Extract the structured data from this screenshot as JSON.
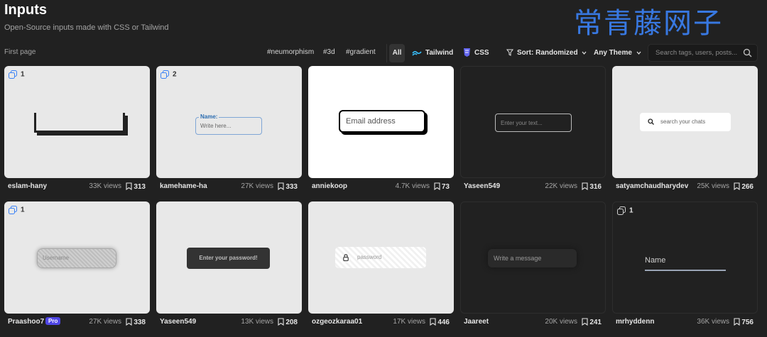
{
  "header": {
    "title": "Inputs",
    "subtitle": "Open-Source inputs made with CSS or Tailwind",
    "watermark": "常青藤网子"
  },
  "toolbar": {
    "first_page": "First page",
    "tags": [
      "#neumorphism",
      "#3d",
      "#gradient"
    ],
    "filters": {
      "all": "All",
      "tailwind": "Tailwind",
      "css": "CSS"
    },
    "sort_label": "Sort: Randomized",
    "theme_label": "Any Theme",
    "search_placeholder": "Search tags, users, posts..."
  },
  "cards": [
    {
      "author": "eslam-hany",
      "views": "33K views",
      "saves": "313",
      "badge": "1",
      "theme": "light"
    },
    {
      "author": "kamehame-ha",
      "views": "27K views",
      "saves": "333",
      "badge": "2",
      "theme": "light",
      "preview_label": "Name:",
      "preview_text": "Write here..."
    },
    {
      "author": "anniekoop",
      "views": "4.7K views",
      "saves": "73",
      "theme": "white",
      "preview_text": "Email address"
    },
    {
      "author": "Yaseen549",
      "views": "22K views",
      "saves": "316",
      "theme": "dark",
      "preview_text": "Enter your text..."
    },
    {
      "author": "satyamchaudharydev",
      "views": "25K views",
      "saves": "266",
      "theme": "light",
      "preview_text": "search your chats"
    },
    {
      "author": "Praashoo7",
      "pro": "Pro",
      "views": "27K views",
      "saves": "338",
      "badge": "1",
      "theme": "light",
      "preview_text": "Username"
    },
    {
      "author": "Yaseen549",
      "views": "13K views",
      "saves": "208",
      "theme": "light",
      "preview_text": "Enter your password!"
    },
    {
      "author": "ozgeozkaraa01",
      "views": "17K views",
      "saves": "446",
      "theme": "light",
      "preview_text": "password"
    },
    {
      "author": "Jaareet",
      "views": "20K views",
      "saves": "241",
      "theme": "dark",
      "preview_text": "Write a message"
    },
    {
      "author": "mrhyddenn",
      "views": "36K views",
      "saves": "756",
      "badge": "1",
      "theme": "dark",
      "preview_text": "Name"
    }
  ]
}
